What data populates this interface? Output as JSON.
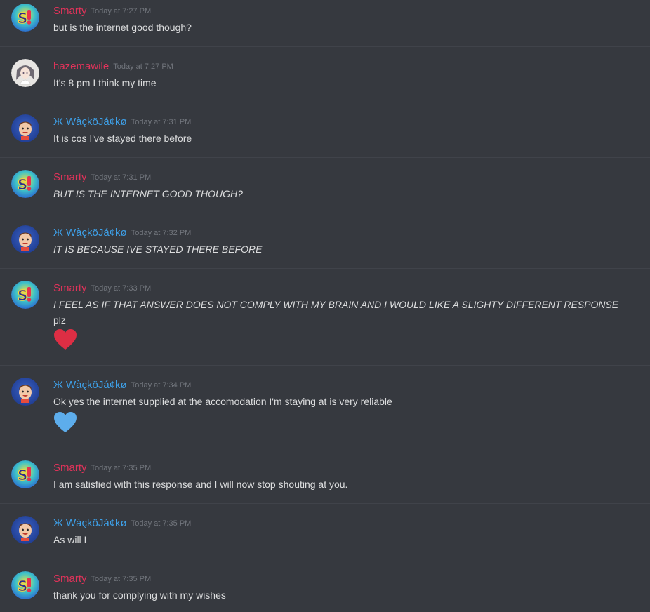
{
  "messages": [
    {
      "user": "Smarty",
      "timestamp": "Today at 7:27 PM",
      "text": "but is the internet good though?"
    },
    {
      "user": "hazemawile",
      "timestamp": "Today at 7:27 PM",
      "text": "It's 8 pm I think my time"
    },
    {
      "user": "Ж WàçköJá¢kø",
      "timestamp": "Today at 7:31 PM",
      "text": "It is cos I've stayed there before"
    },
    {
      "user": "Smarty",
      "timestamp": "Today at 7:31 PM",
      "text": "BUT IS THE INTERNET GOOD THOUGH?"
    },
    {
      "user": "Ж WàçköJá¢kø",
      "timestamp": "Today at 7:32 PM",
      "text": "IT IS BECAUSE IVE STAYED THERE BEFORE"
    },
    {
      "user": "Smarty",
      "timestamp": "Today at 7:33 PM",
      "text": "I FEEL AS IF THAT ANSWER DOES NOT COMPLY WITH MY BRAIN AND I WOULD LIKE A SLIGHTY DIFFERENT RESPONSE",
      "text2": "plz",
      "emoji": "red-heart-emoji"
    },
    {
      "user": "Ж WàçköJá¢kø",
      "timestamp": "Today at 7:34 PM",
      "text": "Ok yes the internet supplied at the accomodation I'm staying at is very reliable",
      "emoji": "blue-heart-emoji"
    },
    {
      "user": "Smarty",
      "timestamp": "Today at 7:35 PM",
      "text": "I am satisfied with this response and I will now stop shouting at you."
    },
    {
      "user": "Ж WàçköJá¢kø",
      "timestamp": "Today at 7:35 PM",
      "text": "As will I"
    },
    {
      "user": "Smarty",
      "timestamp": "Today at 7:35 PM",
      "text": "thank you for complying with my wishes"
    }
  ],
  "colors": {
    "background": "#36393f",
    "smarty_name": "#e0335a",
    "hazemawile_name": "#e0335a",
    "wacko_name": "#3ea0e8",
    "timestamp": "#72767d",
    "text": "#dcddde",
    "red_heart": "#dd2e44",
    "blue_heart": "#5dadec"
  }
}
